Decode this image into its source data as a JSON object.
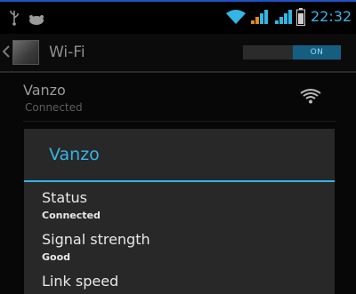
{
  "status_bar": {
    "time": "22:32",
    "accent_color": "#33b5e5"
  },
  "action_bar": {
    "title": "Wi-Fi",
    "toggle_label": "ON"
  },
  "network": {
    "name": "Vanzo",
    "status": "Connected"
  },
  "dialog": {
    "title": "Vanzo",
    "fields": [
      {
        "label": "Status",
        "value": "Connected"
      },
      {
        "label": "Signal strength",
        "value": "Good"
      },
      {
        "label": "Link speed",
        "value": ""
      }
    ]
  }
}
